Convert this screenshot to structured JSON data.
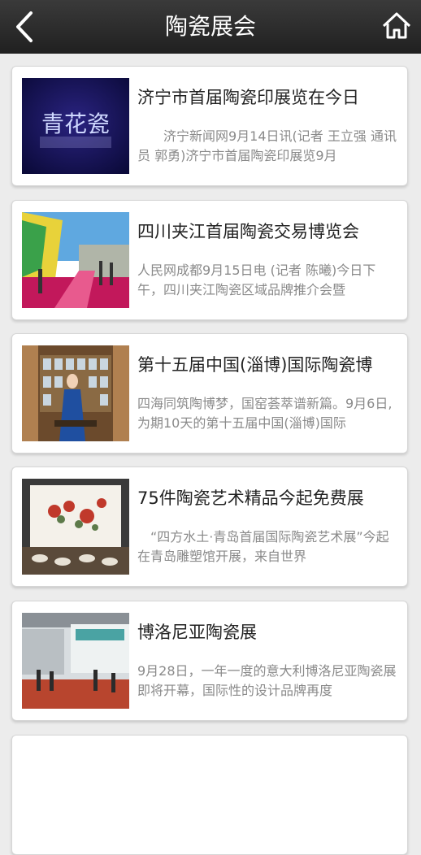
{
  "header": {
    "title": "陶瓷展会",
    "back_icon": "back-chevron-icon",
    "home_icon": "home-icon"
  },
  "articles": [
    {
      "title": "济宁市首届陶瓷印展览在今日",
      "summary": "　　济宁新闻网9月14日讯(记者 王立强 通讯员 郭勇)济宁市首届陶瓷印展览9月",
      "thumb_text": "青花瓷"
    },
    {
      "title": "四川夹江首届陶瓷交易博览会",
      "summary": "人民网成都9月15日电 (记者 陈曦)今日下午，四川夹江陶瓷区域品牌推介会暨"
    },
    {
      "title": "第十五届中国(淄博)国际陶瓷博",
      "summary": "四海同筑陶博梦，国窑荟萃谱新篇。9月6日,为期10天的第十五届中国(淄博)国际"
    },
    {
      "title": "75件陶瓷艺术精品今起免费展",
      "summary": "　“四方水土·青岛首届国际陶瓷艺术展”今起在青岛雕塑馆开展，来自世界"
    },
    {
      "title": "博洛尼亚陶瓷展",
      "summary": "9月28日，一年一度的意大利博洛尼亚陶瓷展即将开幕，国际性的设计品牌再度"
    }
  ]
}
